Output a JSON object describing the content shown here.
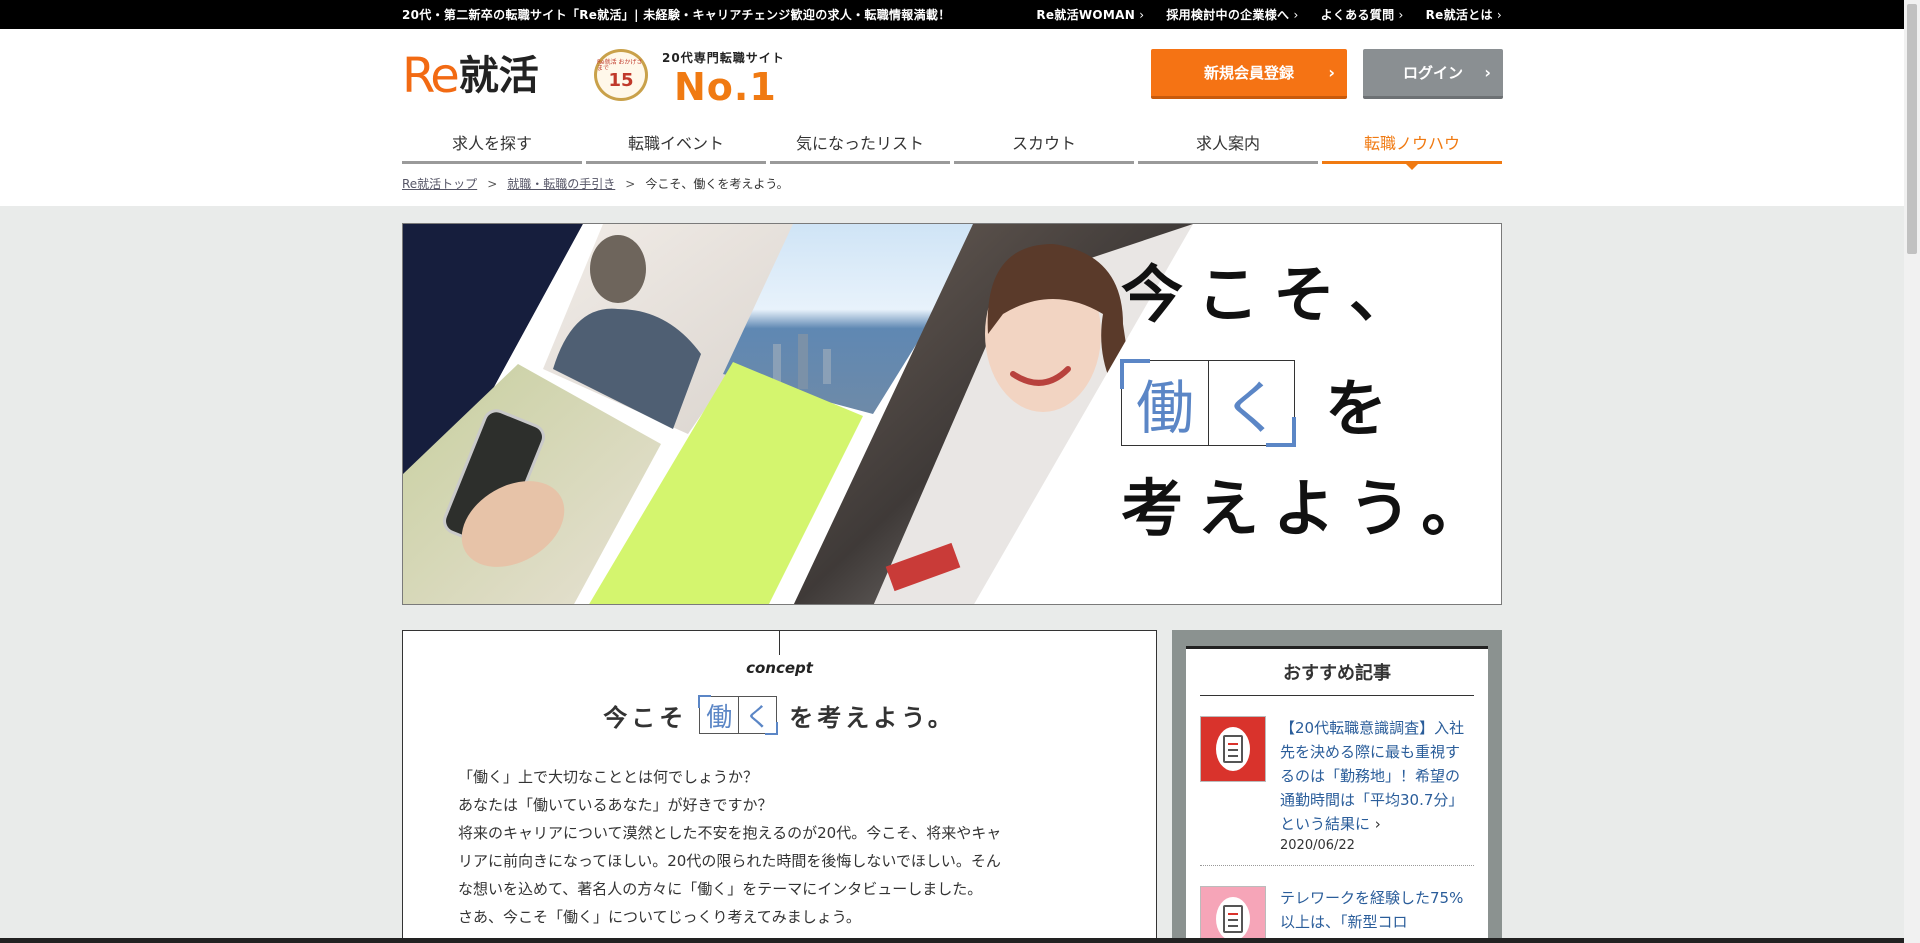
{
  "topbar": {
    "tagline": "20代・第二新卒の転職サイト「Re就活」| 未経験・キャリアチェンジ歓迎の求人・転職情報満載！",
    "links": [
      "Re就活WOMAN",
      "採用検討中の企業様へ",
      "よくある質問",
      "Re就活とは"
    ]
  },
  "header": {
    "logo_re": "Re",
    "logo_jp": "就活",
    "badge_text_small": "Re就活 おかげさまで",
    "badge_number": "15",
    "no1_sub": "20代専門転職サイト",
    "no1_big": "No.1",
    "register_label": "新規会員登録",
    "login_label": "ログイン"
  },
  "nav": {
    "items": [
      "求人を探す",
      "転職イベント",
      "気になったリスト",
      "スカウト",
      "求人案内",
      "転職ノウハウ"
    ]
  },
  "breadcrumb": {
    "home": "Re就活トップ",
    "section": "就職・転職の手引き",
    "current": "今こそ、働くを考えよう。",
    "separator": ">"
  },
  "hero": {
    "line1": "今こそ、",
    "kanji1": "働",
    "kanji2": "く",
    "wo": "を",
    "line3": "考えよう。"
  },
  "concept": {
    "label": "concept",
    "title_prefix": "今こそ",
    "kanji1": "働",
    "kanji2": "く",
    "title_suffix": "を考えよう。",
    "body": [
      "「働く」上で大切なこととは何でしょうか？",
      "あなたは「働いているあなた」が好きですか？",
      "将来のキャリアについて漠然とした不安を抱えるのが20代。今こそ、将来やキャ",
      "リアに前向きになってほしい。20代の限られた時間を後悔しないでほしい。そん",
      "な想いを込めて、著名人の方々に「働く」をテーマにインタビューしました。",
      "さあ、今こそ「働く」についてじっくり考えてみましょう。"
    ]
  },
  "sidebar": {
    "title": "おすすめ記事",
    "articles": [
      {
        "title": "【20代転職意識調査】入社先を決める際に最も重視するのは「勤務地」！希望の通勤時間は「平均30.7分」という結果に",
        "date": "2020/06/22"
      },
      {
        "title": "テレワークを経験した75%以上は、「新型コロ",
        "date": ""
      }
    ]
  },
  "colors": {
    "accent": "#f07a12",
    "register_button": "#f57314",
    "login_button": "#8a8f92",
    "kanji_blue": "#5b86c6",
    "lime": "#d4f56e",
    "navy": "#161e3d"
  }
}
